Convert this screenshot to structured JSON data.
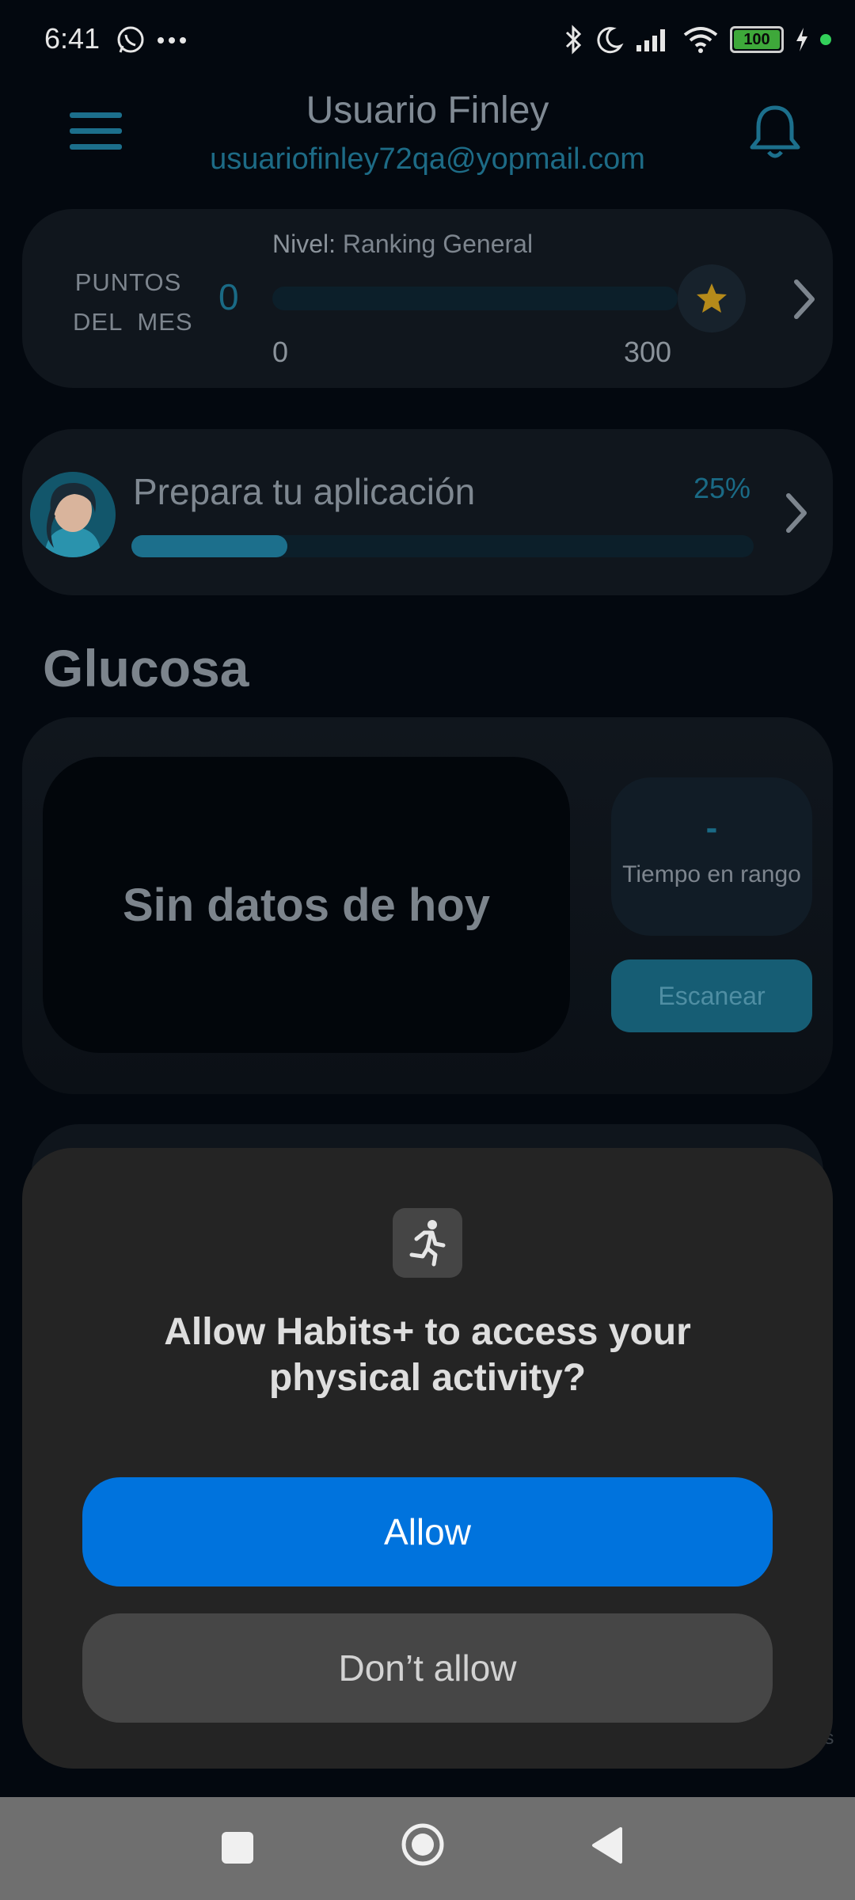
{
  "status_bar": {
    "time": "6:41",
    "battery_level": "100",
    "icons": [
      "whatsapp-icon",
      "more-dots-icon",
      "bluetooth-icon",
      "moon-icon",
      "signal-icon",
      "wifi-icon",
      "battery-icon",
      "charging-icon"
    ]
  },
  "header": {
    "user_name": "Usuario Finley",
    "email": "usuariofinley72qa@yopmail.com"
  },
  "points_card": {
    "label_line1": "PUNTOS",
    "label_line2": "DEL  MES",
    "value": "0",
    "level_label": "Nivel:",
    "level_value": "Ranking General",
    "min": "0",
    "max": "300",
    "progress": 0
  },
  "setup_card": {
    "title": "Prepara tu aplicación",
    "percent_label": "25%",
    "progress": 0.25
  },
  "glucose": {
    "section_title": "Glucosa",
    "no_data_text": "Sin datos de hoy",
    "tir_value": "-",
    "tir_label": "Tiempo en rango",
    "scan_button": "Escanear"
  },
  "background_fragment": "os",
  "permission_dialog": {
    "title": "Allow Habits+ to access your physical activity?",
    "allow_label": "Allow",
    "deny_label": "Don’t allow"
  },
  "colors": {
    "accent": "#1c6f8c",
    "allow_blue": "#0073dd",
    "star": "#b58a1a"
  }
}
